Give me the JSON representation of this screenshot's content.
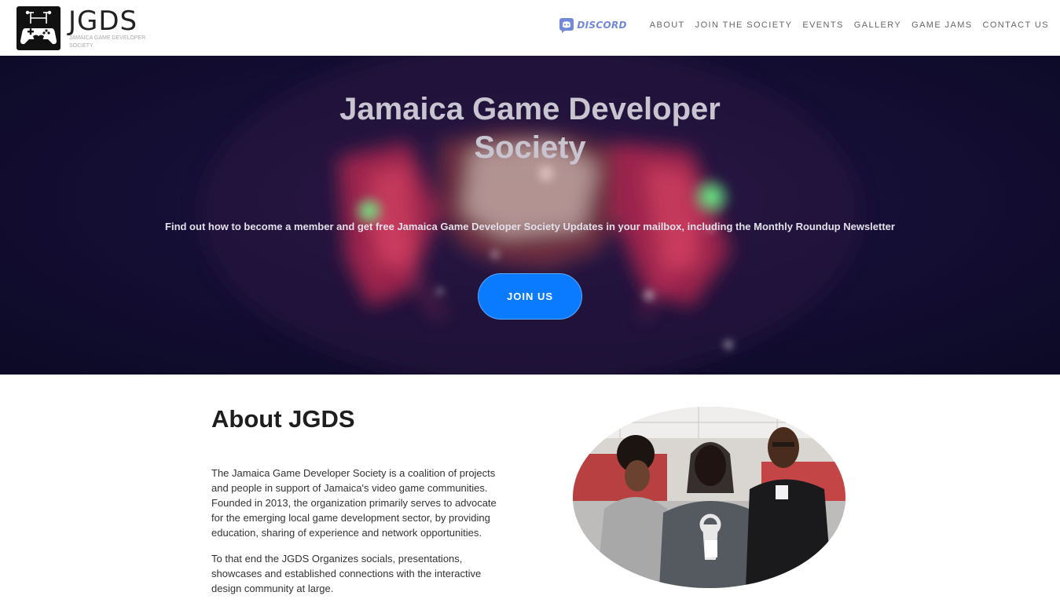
{
  "header": {
    "logo": {
      "text": "JGDS",
      "subtitle": "Jamaica Game Developer Society"
    },
    "discord_label": "DISCORD",
    "nav": [
      {
        "label": "ABOUT"
      },
      {
        "label": "JOIN THE SOCIETY"
      },
      {
        "label": "EVENTS"
      },
      {
        "label": "GALLERY"
      },
      {
        "label": "GAME JAMS"
      },
      {
        "label": "CONTACT US"
      }
    ]
  },
  "hero": {
    "title_line1": "Jamaica Game Developer",
    "title_line2": "Society",
    "subtitle": "Find out how to become a member and get free Jamaica Game Developer Society Updates in your mailbox, including the Monthly Roundup Newsletter",
    "cta_label": "JOIN US"
  },
  "about": {
    "title": "About JGDS",
    "paragraph1": "The Jamaica Game Developer Society is a coalition of projects and people in support of Jamaica's video game communities. Founded in 2013, the organization primarily serves to advocate for the emerging local game development sector, by providing education, sharing of experience and network opportunities.",
    "paragraph2": "To that end the JGDS Organizes socials, presentations, showcases and established connections with the interactive design community at large."
  },
  "colors": {
    "accent": "#0a7bff",
    "discord": "#7289da",
    "hero_bg": "#160f36"
  }
}
